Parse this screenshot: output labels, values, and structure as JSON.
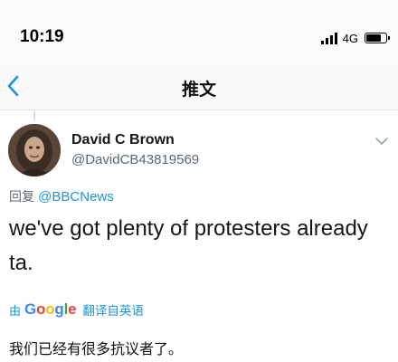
{
  "status_bar": {
    "time": "10:19",
    "network": "4G",
    "battery_level": 0.8
  },
  "nav": {
    "back_icon": "chevron-left-icon",
    "title": "推文"
  },
  "tweet": {
    "author": {
      "display_name": "David C Brown",
      "handle": "@DavidCB43819569"
    },
    "reply_prefix": "回复",
    "reply_to": "@BBCNews",
    "text": "we've got plenty of protesters already ta.",
    "translate": {
      "prefix": "由",
      "provider": "Google",
      "label": "翻译自英语"
    },
    "translation": "我们已经有很多抗议者了。"
  },
  "colors": {
    "link": "#1b95e0",
    "secondary_text": "#5b6770",
    "primary_text": "#14171a"
  }
}
